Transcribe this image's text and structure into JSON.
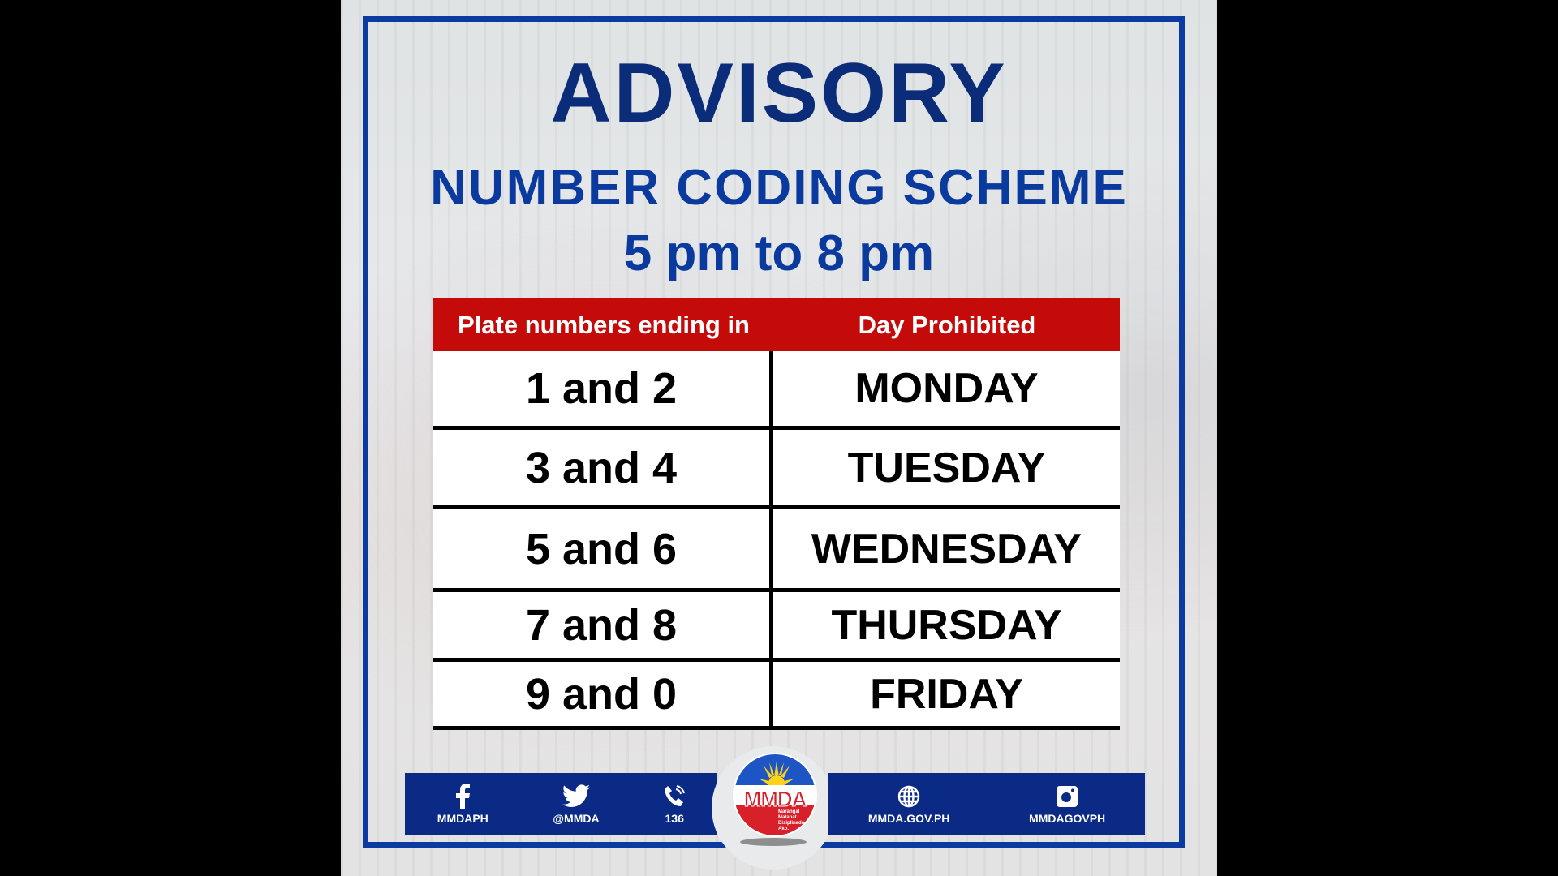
{
  "poster": {
    "title": "ADVISORY",
    "subtitle": "NUMBER CODING SCHEME",
    "time_window": "5 pm to 8 pm",
    "table": {
      "headers": [
        "Plate numbers ending in",
        "Day Prohibited"
      ],
      "rows": [
        {
          "plates": "1 and 2",
          "day": "MONDAY"
        },
        {
          "plates": "3 and 4",
          "day": "TUESDAY"
        },
        {
          "plates": "5 and 6",
          "day": "WEDNESDAY"
        },
        {
          "plates": "7 and 8",
          "day": "THURSDAY"
        },
        {
          "plates": "9 and 0",
          "day": "FRIDAY"
        }
      ]
    },
    "footer": {
      "left": [
        {
          "icon": "facebook-icon",
          "label": "MMDAPH"
        },
        {
          "icon": "twitter-icon",
          "label": "@MMDA"
        },
        {
          "icon": "phone-icon",
          "label": "136"
        }
      ],
      "right": [
        {
          "icon": "globe-icon",
          "label": "MMDA.GOV.PH"
        },
        {
          "icon": "instagram-icon",
          "label": "MMDAGOVPH"
        }
      ],
      "logo": {
        "text": "MMDA",
        "motto": [
          "Marangal",
          "Matapat",
          "Disiplinado",
          "Ako."
        ]
      }
    }
  },
  "colors": {
    "navy": "#0a2a86",
    "title_blue": "#0b2c78",
    "frame_blue": "#0b3aa0",
    "header_red": "#c50a0a",
    "letterbox": "#000000"
  }
}
